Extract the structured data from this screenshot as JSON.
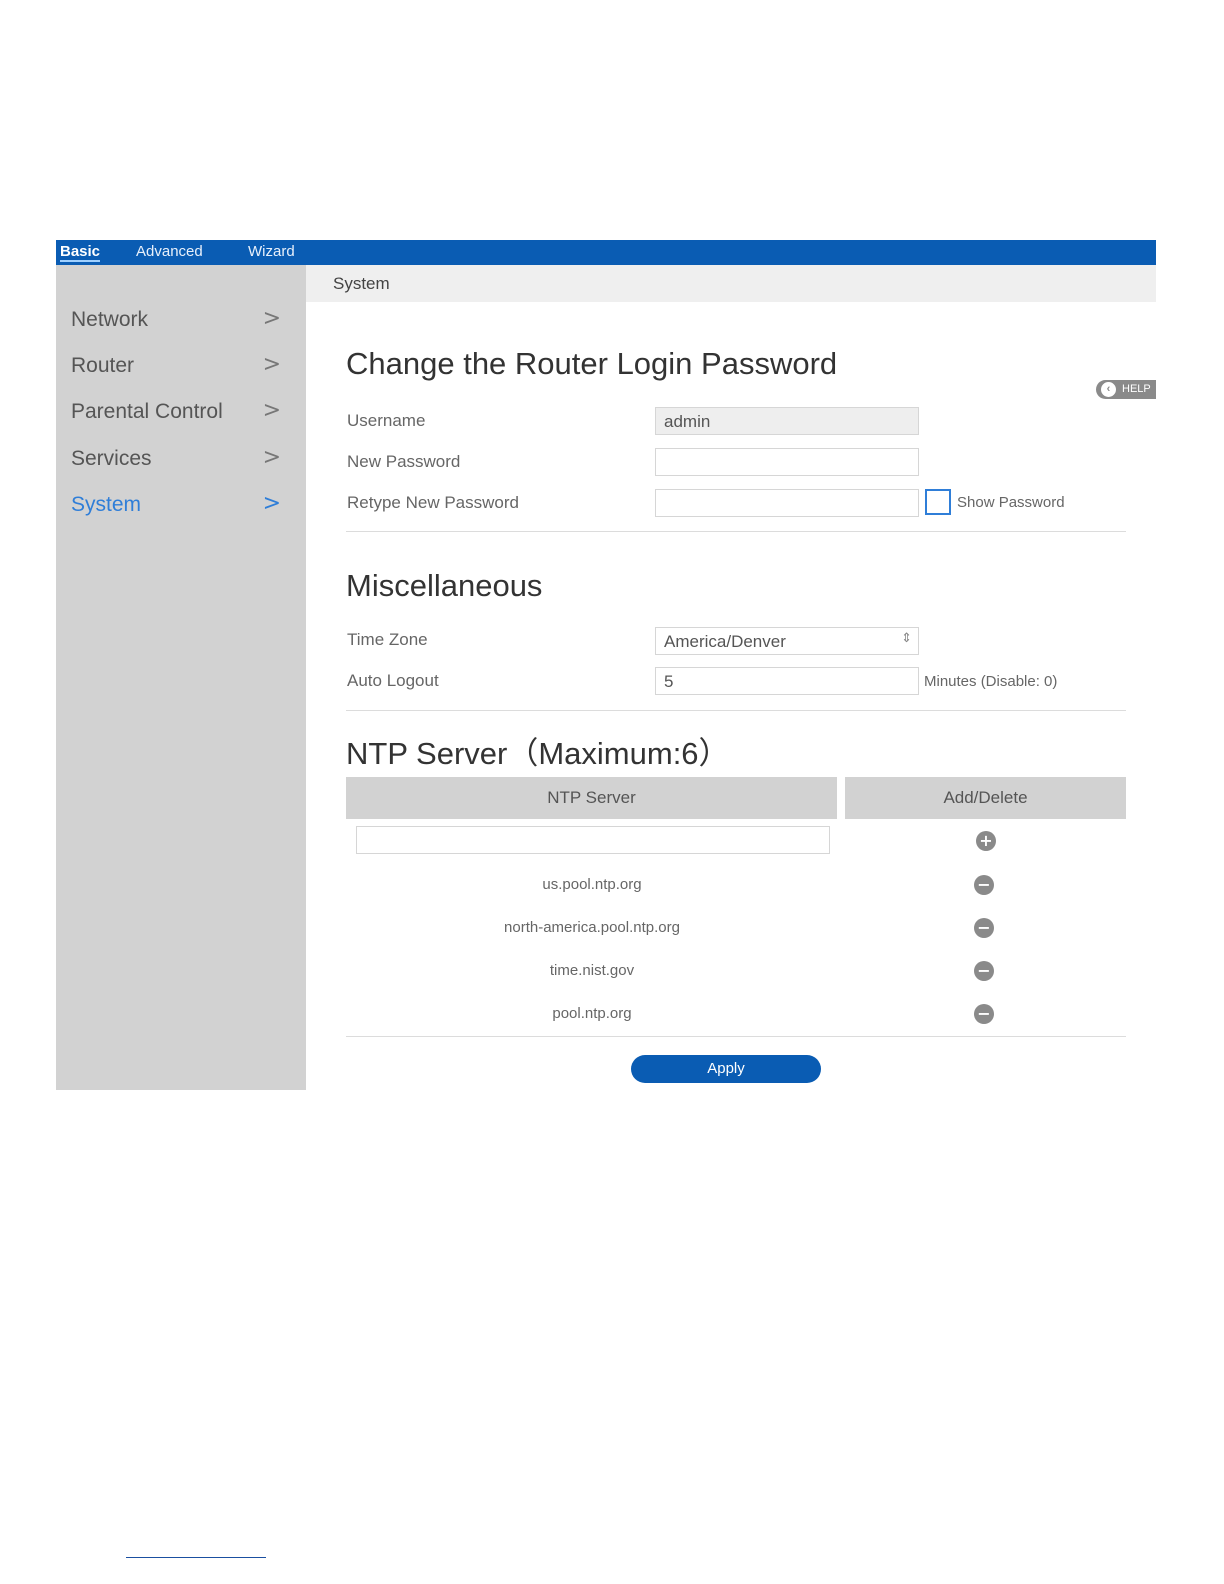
{
  "topnav": {
    "tabs": [
      {
        "label": "Basic"
      },
      {
        "label": "Advanced"
      },
      {
        "label": "Wizard"
      }
    ]
  },
  "sidebar": {
    "items": [
      {
        "label": "Network"
      },
      {
        "label": "Router"
      },
      {
        "label": "Parental Control"
      },
      {
        "label": "Services"
      },
      {
        "label": "System"
      }
    ],
    "chevron": ">"
  },
  "breadcrumb": {
    "label": "System"
  },
  "help": {
    "label": "HELP"
  },
  "password_section": {
    "title": "Change the Router Login Password",
    "username_label": "Username",
    "username_value": "admin",
    "new_password_label": "New Password",
    "retype_password_label": "Retype New Password",
    "show_password_label": "Show Password"
  },
  "misc_section": {
    "title": "Miscellaneous",
    "timezone_label": "Time Zone",
    "timezone_value": "America/Denver",
    "auto_logout_label": "Auto Logout",
    "auto_logout_value": "5",
    "auto_logout_note": "Minutes (Disable: 0)"
  },
  "ntp_section": {
    "title": "NTP Server（Maximum:6）",
    "col_server": "NTP Server",
    "col_action": "Add/Delete",
    "servers": [
      "us.pool.ntp.org",
      "north-america.pool.ntp.org",
      "time.nist.gov",
      "pool.ntp.org"
    ]
  },
  "apply_label": "Apply",
  "colors": {
    "accent": "#0a5cb3",
    "active_link": "#2f7ed8",
    "sidebar_bg": "#d2d2d2"
  }
}
